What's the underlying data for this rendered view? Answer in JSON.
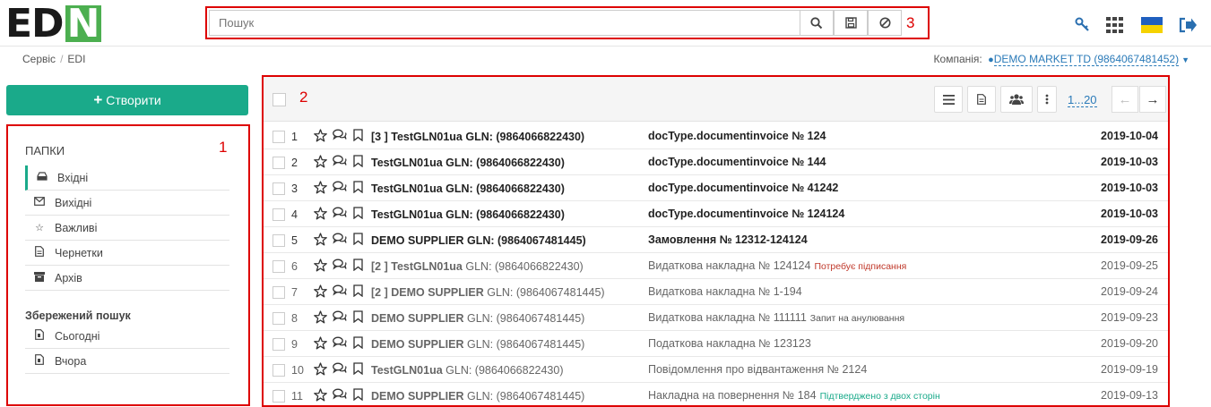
{
  "logo": {
    "text_main": "ED",
    "text_accent": "N"
  },
  "search": {
    "placeholder": "Пошук",
    "marker": "3"
  },
  "top_icons": [
    "key-icon",
    "apps-grid-icon",
    "ukraine-flag-icon",
    "logout-icon"
  ],
  "breadcrumb": {
    "items": [
      "Сервіс",
      "EDI"
    ],
    "separator": "/"
  },
  "company": {
    "label": "Компанія:",
    "value": "DEMO MARKET TD (9864067481452)"
  },
  "create_button": {
    "label": "Створити"
  },
  "left_panel": {
    "marker": "1",
    "folders_title": "ПАПКИ",
    "folders": [
      {
        "label": "Вхідні",
        "icon": "inbox-icon",
        "glyph": "▭"
      },
      {
        "label": "Вихідні",
        "icon": "envelope-icon",
        "glyph": "✉"
      },
      {
        "label": "Важливі",
        "icon": "star-icon",
        "glyph": "☆"
      },
      {
        "label": "Чернетки",
        "icon": "draft-document-icon",
        "glyph": "▯"
      },
      {
        "label": "Архів",
        "icon": "archive-icon",
        "glyph": "▆"
      }
    ],
    "saved_title": "Збережений пошук",
    "saved": [
      {
        "label": "Сьогодні",
        "icon": "saved-search-file-icon"
      },
      {
        "label": "Вчора",
        "icon": "saved-search-file-icon"
      }
    ]
  },
  "main": {
    "marker": "2",
    "pager": "1...20",
    "rows": [
      {
        "num": "1",
        "sender_prefix": "[3 ] ",
        "sender_name": "TestGLN01ua",
        "sender_gln": "GLN: (9864066822430)",
        "doc": "docType.documentinvoice № 124",
        "tag": "",
        "date": "2019-10-04",
        "unread": true
      },
      {
        "num": "2",
        "sender_prefix": "",
        "sender_name": "TestGLN01ua",
        "sender_gln": "GLN: (9864066822430)",
        "doc": "docType.documentinvoice № 144",
        "tag": "",
        "date": "2019-10-03",
        "unread": true
      },
      {
        "num": "3",
        "sender_prefix": "",
        "sender_name": "TestGLN01ua",
        "sender_gln": "GLN: (9864066822430)",
        "doc": "docType.documentinvoice № 41242",
        "tag": "",
        "date": "2019-10-03",
        "unread": true
      },
      {
        "num": "4",
        "sender_prefix": "",
        "sender_name": "TestGLN01ua",
        "sender_gln": "GLN: (9864066822430)",
        "doc": "docType.documentinvoice № 124124",
        "tag": "",
        "date": "2019-10-03",
        "unread": true
      },
      {
        "num": "5",
        "sender_prefix": "",
        "sender_name": "DEMO SUPPLIER",
        "sender_gln": "GLN: (9864067481445)",
        "doc": "Замовлення № 12312-124124",
        "tag": "",
        "date": "2019-09-26",
        "unread": true
      },
      {
        "num": "6",
        "sender_prefix": "[2 ] ",
        "sender_name": "TestGLN01ua",
        "sender_gln": "GLN: (9864066822430)",
        "doc": "Видаткова накладна № 124124",
        "tag": "Потребує підписання",
        "tag_color": "#c0392b",
        "date": "2019-09-25",
        "unread": false
      },
      {
        "num": "7",
        "sender_prefix": "[2 ] ",
        "sender_name": "DEMO SUPPLIER",
        "sender_gln": "GLN: (9864067481445)",
        "doc": "Видаткова накладна № 1-194",
        "tag": "",
        "date": "2019-09-24",
        "unread": false
      },
      {
        "num": "8",
        "sender_prefix": "",
        "sender_name": "DEMO SUPPLIER",
        "sender_gln": "GLN: (9864067481445)",
        "doc": "Видаткова накладна № 111111",
        "tag": "Запит на анулювання",
        "tag_color": "#555555",
        "date": "2019-09-23",
        "unread": false
      },
      {
        "num": "9",
        "sender_prefix": "",
        "sender_name": "DEMO SUPPLIER",
        "sender_gln": "GLN: (9864067481445)",
        "doc": "Податкова накладна № 123123",
        "tag": "",
        "date": "2019-09-20",
        "unread": false
      },
      {
        "num": "10",
        "sender_prefix": "",
        "sender_name": "TestGLN01ua",
        "sender_gln": "GLN: (9864066822430)",
        "doc": "Повідомлення про відвантаження № 2124",
        "tag": "",
        "date": "2019-09-19",
        "unread": false
      },
      {
        "num": "11",
        "sender_prefix": "",
        "sender_name": "DEMO SUPPLIER",
        "sender_gln": "GLN: (9864067481445)",
        "doc": "Накладна на повернення № 184",
        "tag": "Підтверджено з двох сторін",
        "tag_color": "#1aaa8a",
        "date": "2019-09-13",
        "unread": false
      }
    ]
  },
  "colors": {
    "accent": "#1aaa8a",
    "annotation_red": "#dd0000",
    "link": "#2a7ab8"
  }
}
